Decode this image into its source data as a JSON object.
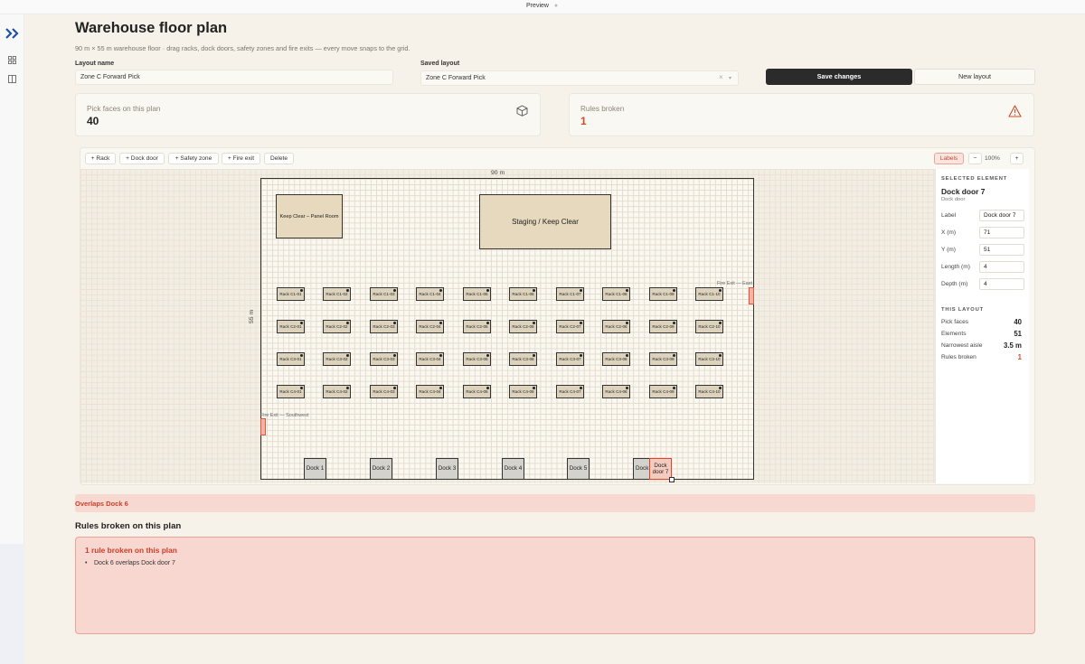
{
  "window": {
    "title": "Preview"
  },
  "page": {
    "title": "Warehouse floor plan",
    "subtitle": "90 m × 55 m warehouse floor · drag racks, dock doors, safety zones and fire exits — every move snaps to the grid."
  },
  "form": {
    "layout_name_label": "Layout name",
    "layout_name_value": "Zone C Forward Pick",
    "saved_layout_label": "Saved layout",
    "saved_layout_value": "Zone C Forward Pick",
    "save_button": "Save changes",
    "new_button": "New layout"
  },
  "stats": {
    "pick_faces_label": "Pick faces on this plan",
    "pick_faces_value": "40",
    "rules_label": "Rules broken",
    "rules_value": "1"
  },
  "toolbar": {
    "add_rack": "+ Rack",
    "add_dock": "+ Dock door",
    "add_safety": "+ Safety zone",
    "add_exit": "+ Fire exit",
    "delete": "Delete",
    "labels": "Labels",
    "zoom_out": "−",
    "zoom": "100%",
    "zoom_in": "+"
  },
  "canvas": {
    "width_label": "90 m",
    "height_label": "55 m",
    "zones": [
      "Keep Clear – Panel Room",
      "Staging / Keep Clear"
    ],
    "racks": [
      [
        "Rack C1-01",
        "Rack C1-02",
        "Rack C1-03",
        "Rack C1-04",
        "Rack C1-05",
        "Rack C1-06",
        "Rack C1-07",
        "Rack C1-08",
        "Rack C1-09",
        "Rack C1-10"
      ],
      [
        "Rack C2-01",
        "Rack C2-02",
        "Rack C2-03",
        "Rack C2-04",
        "Rack C2-05",
        "Rack C2-06",
        "Rack C2-07",
        "Rack C2-08",
        "Rack C2-09",
        "Rack C2-10"
      ],
      [
        "Rack C3-01",
        "Rack C3-02",
        "Rack C3-03",
        "Rack C3-04",
        "Rack C3-05",
        "Rack C3-06",
        "Rack C3-07",
        "Rack C3-08",
        "Rack C3-09",
        "Rack C3-10"
      ],
      [
        "Rack C4-01",
        "Rack C4-02",
        "Rack C4-03",
        "Rack C4-04",
        "Rack C4-05",
        "Rack C4-06",
        "Rack C4-07",
        "Rack C4-08",
        "Rack C4-09",
        "Rack C4-10"
      ]
    ],
    "docks": [
      "Dock 1",
      "Dock 2",
      "Dock 3",
      "Dock 4",
      "Dock 5",
      "Dock",
      "Dock door 7"
    ],
    "exit_east": "Fire Exit — East",
    "exit_southwest": "Fire Exit — Southwest"
  },
  "inspector": {
    "section_title": "SELECTED ELEMENT",
    "element_name": "Dock door 7",
    "element_type": "Dock door",
    "label_label": "Label",
    "label_value": "Dock door 7",
    "x_label": "X (m)",
    "x_value": "71",
    "y_label": "Y (m)",
    "y_value": "51",
    "length_label": "Length (m)",
    "length_value": "4",
    "depth_label": "Depth (m)",
    "depth_value": "4",
    "layout_title": "THIS LAYOUT",
    "pick_faces_label": "Pick faces",
    "pick_faces_value": "40",
    "elements_label": "Elements",
    "elements_value": "51",
    "aisle_label": "Narrowest aisle",
    "aisle_value": "3.5 m",
    "rules_label": "Rules broken",
    "rules_value": "1"
  },
  "alerts": {
    "overlap_message": "Overlaps Dock 6",
    "rules_heading": "Rules broken on this plan",
    "rules_count_text": "1 rule broken on this plan",
    "rules_items": [
      "Dock 6 overlaps Dock door 7"
    ]
  },
  "colors": {
    "background": "#f6f2e9",
    "accent_dark": "#2b2b2b",
    "error": "#d04a2a",
    "error_bg": "#f8d7d0",
    "zone_fill": "#e6d9be",
    "rack_fill": "#ddd3bd"
  }
}
